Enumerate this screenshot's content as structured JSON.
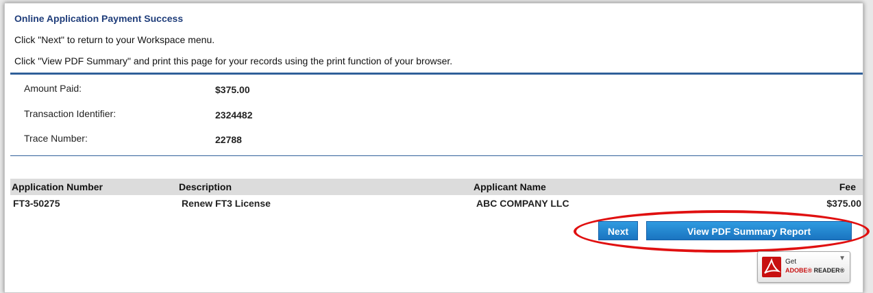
{
  "header": {
    "title": "Online Application Payment Success",
    "instruction_1": "Click \"Next\" to return to your Workspace menu.",
    "instruction_2": "Click \"View PDF Summary\" and print this page for your records using the print function of your browser."
  },
  "payment": {
    "amount_label": "Amount Paid:",
    "amount_value": "$375.00",
    "transaction_label": "Transaction Identifier:",
    "transaction_value": "2324482",
    "trace_label": "Trace Number:",
    "trace_value": "22788"
  },
  "table": {
    "columns": [
      "Application Number",
      "Description",
      "Applicant Name",
      "Fee"
    ],
    "rows": [
      [
        "FT3-50275",
        "Renew FT3 License",
        "ABC COMPANY LLC",
        "$375.00"
      ]
    ]
  },
  "actions": {
    "next_label": "Next",
    "pdf_label": "View PDF Summary Report"
  },
  "adobe_badge": {
    "get": "Get",
    "brand": "ADOBE",
    "product": "READER"
  },
  "colors": {
    "title": "#1f3d7a",
    "rule": "#2f5f99",
    "button": "#1a74c0",
    "highlight": "#e01010",
    "adobe_red": "#c81010"
  }
}
